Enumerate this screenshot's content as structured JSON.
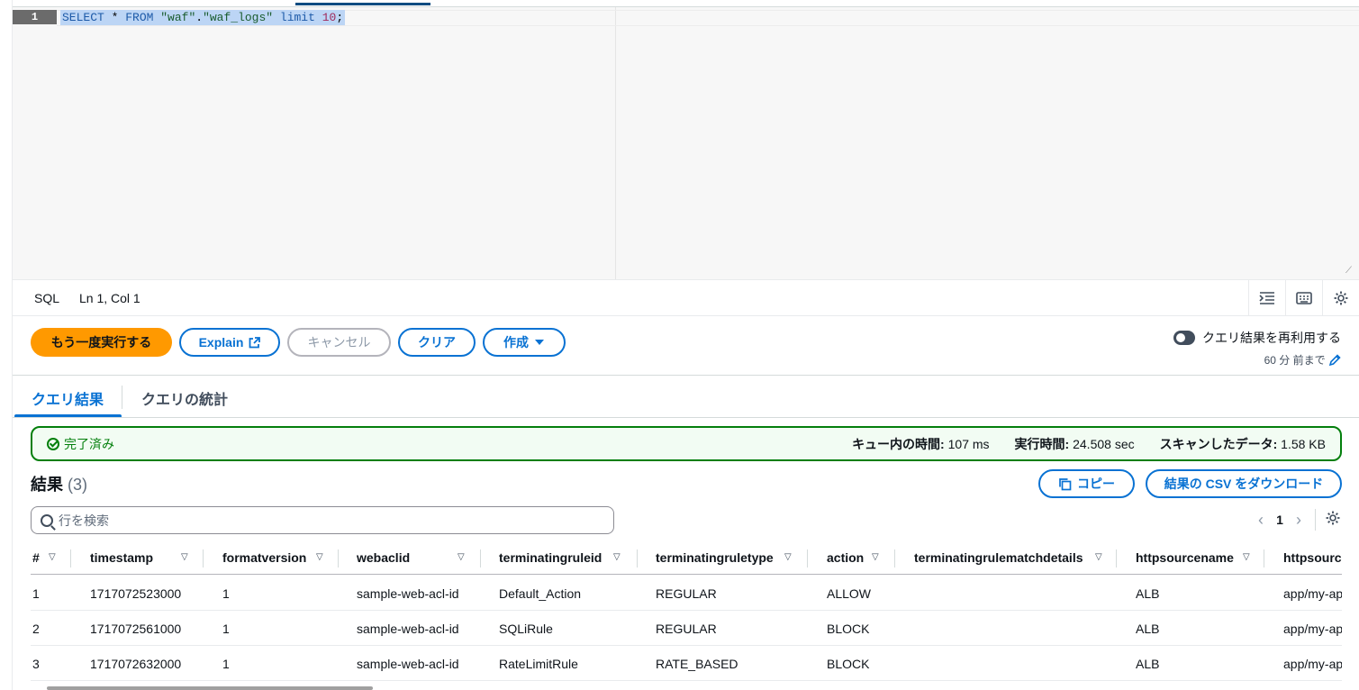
{
  "editor": {
    "line_number": "1",
    "query": {
      "kw1": "SELECT",
      "star": " * ",
      "kw2": "FROM",
      "space1": " ",
      "str1": "\"waf\"",
      "dot": ".",
      "str2": "\"waf_logs\"",
      "space2": " ",
      "kw3": "limit",
      "space3": " ",
      "num": "10",
      "semi": ";"
    }
  },
  "statusbar": {
    "language": "SQL",
    "position": "Ln 1, Col 1",
    "icons": [
      "indent-icon",
      "keyboard-icon",
      "settings-icon"
    ]
  },
  "actions": {
    "run_again": "もう一度実行する",
    "explain": "Explain",
    "cancel": "キャンセル",
    "clear": "クリア",
    "create": "作成",
    "reuse_label": "クエリ結果を再利用する",
    "reuse_sub": "60 分 前まで"
  },
  "tabs": {
    "results": "クエリ結果",
    "stats": "クエリの統計"
  },
  "status": {
    "completed": "完了済み",
    "queue_label": "キュー内の時間:",
    "queue_value": "107 ms",
    "exec_label": "実行時間:",
    "exec_value": "24.508 sec",
    "scan_label": "スキャンしたデータ:",
    "scan_value": "1.58 KB",
    "color": "#037f0c"
  },
  "results": {
    "title": "結果",
    "count": "(3)",
    "copy": "コピー",
    "download": "結果の CSV をダウンロード",
    "search_placeholder": "行を検索",
    "page": "1"
  },
  "table": {
    "columns": [
      "#",
      "timestamp",
      "formatversion",
      "webaclid",
      "terminatingruleid",
      "terminatingruletype",
      "action",
      "terminatingrulematchdetails",
      "httpsourcename",
      "httpsourcei"
    ],
    "rows": [
      [
        "1",
        "1717072523000",
        "1",
        "sample-web-acl-id",
        "Default_Action",
        "REGULAR",
        "ALLOW",
        "",
        "ALB",
        "app/my-ap"
      ],
      [
        "2",
        "1717072561000",
        "1",
        "sample-web-acl-id",
        "SQLiRule",
        "REGULAR",
        "BLOCK",
        "",
        "ALB",
        "app/my-ap"
      ],
      [
        "3",
        "1717072632000",
        "1",
        "sample-web-acl-id",
        "RateLimitRule",
        "RATE_BASED",
        "BLOCK",
        "",
        "ALB",
        "app/my-ap"
      ]
    ]
  },
  "colors": {
    "accent": "#0972d3",
    "primary_button": "#ff9900"
  }
}
